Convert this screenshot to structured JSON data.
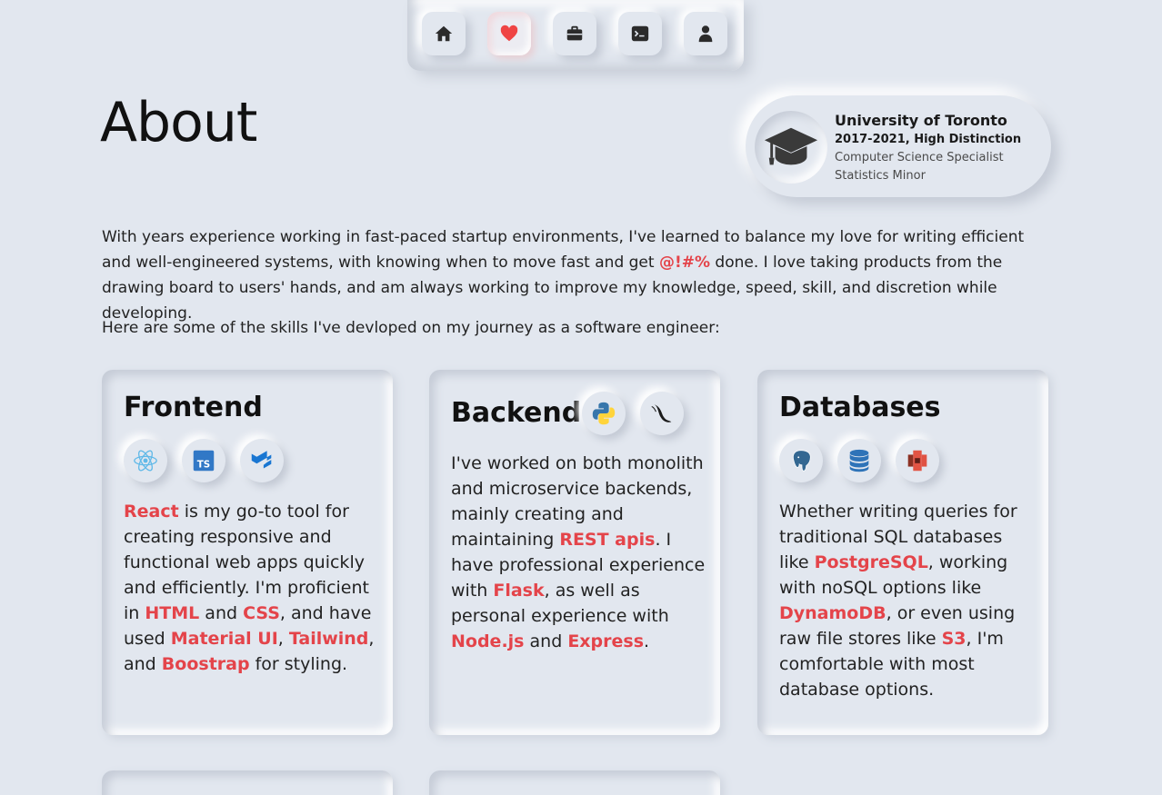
{
  "nav": {
    "items": [
      {
        "name": "home",
        "icon": "home-icon",
        "active": false
      },
      {
        "name": "about",
        "icon": "heart-icon",
        "active": true
      },
      {
        "name": "work",
        "icon": "briefcase-icon",
        "active": false
      },
      {
        "name": "projects",
        "icon": "terminal-icon",
        "active": false
      },
      {
        "name": "contact",
        "icon": "person-icon",
        "active": false
      }
    ],
    "active_color": "#ef4444"
  },
  "page": {
    "title": "About"
  },
  "education": {
    "school": "University of Toronto",
    "years": "2017-2021, High Distinction",
    "major": "Computer Science Specialist",
    "minor": "Statistics Minor",
    "icon": "graduation-cap-icon"
  },
  "intro": {
    "p1_a": "With years experience working in fast-paced startup environments, I've learned to balance my love for writing efficient and well-engineered systems, with knowing when to move fast and get ",
    "p1_hl": "@!#%",
    "p1_b": " done. I love taking products from the drawing board to users' hands, and am always working to improve my knowledge, speed, skill, and discretion while developing.",
    "p2": "Here are some of the skills I've devloped on my journey as a software engineer:"
  },
  "accent_color": "#e4444a",
  "cards": {
    "frontend": {
      "title": "Frontend",
      "icons": [
        "react-icon",
        "typescript-icon",
        "material-ui-icon"
      ],
      "t1": "React",
      "t2": " is my go-to tool for creating responsive and functional web apps quickly and efficiently. I'm proficient in ",
      "t3": "HTML",
      "t4": " and ",
      "t5": "CSS",
      "t6": ", and have used ",
      "t7": "Material UI",
      "t8": ", ",
      "t9": "Tailwind",
      "t10": ", and ",
      "t11": "Boostrap",
      "t12": " for styling."
    },
    "backend": {
      "title": "Backend",
      "icons": [
        "python-icon",
        "flask-icon"
      ],
      "t1": "I've worked on both monolith and microservice backends, mainly creating and maintaining ",
      "t2": "REST apis",
      "t3": ". I have professional experience with ",
      "t4": "Flask",
      "t5": ", as well as personal experience with ",
      "t6": "Node.js",
      "t7": " and ",
      "t8": "Express",
      "t9": "."
    },
    "databases": {
      "title": "Databases",
      "icons": [
        "postgresql-icon",
        "dynamodb-icon",
        "s3-icon"
      ],
      "t1": "Whether writing queries for traditional SQL databases like ",
      "t2": "PostgreSQL",
      "t3": ", working with noSQL options like ",
      "t4": "DynamoDB",
      "t5": ", or even using raw file stores like ",
      "t6": "S3",
      "t7": ", I'm comfortable with most database options."
    }
  }
}
